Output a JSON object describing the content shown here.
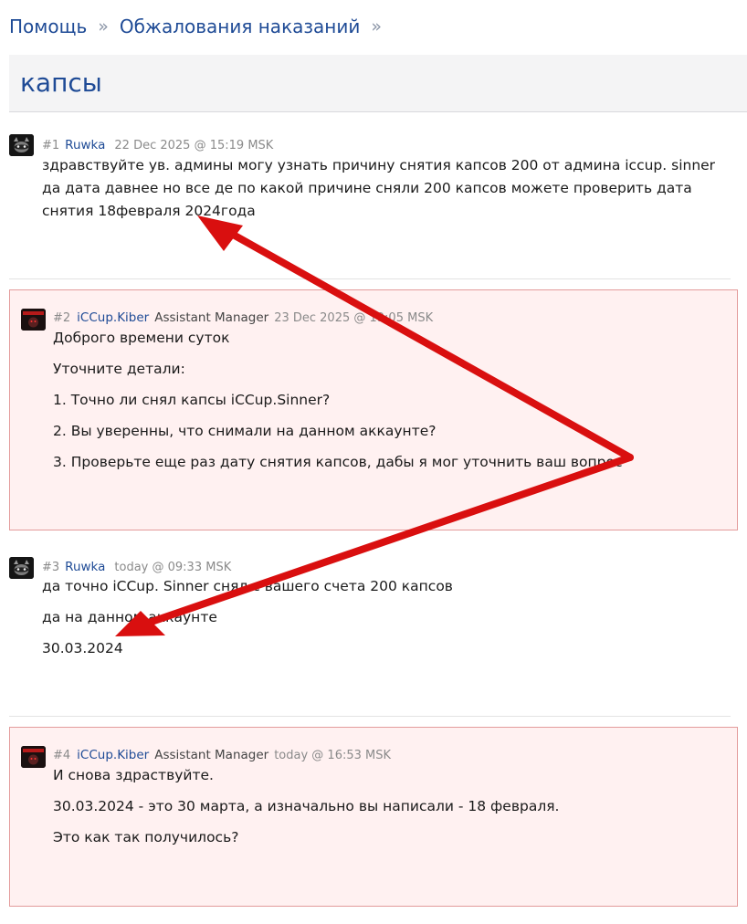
{
  "breadcrumb": {
    "items": [
      "Помощь",
      "Обжалования наказаний"
    ],
    "separator": "»"
  },
  "thread": {
    "title": "капсы"
  },
  "posts": [
    {
      "number": "#1",
      "author": "Ruwka",
      "role": "",
      "date": "22 Dec 2025 @ 15:19 MSK",
      "paragraphs": [
        "здравствуйте ув. админы могу узнать причину снятия капсов 200 от админа iccup. sinner да дата давнее но все де по какой причине сняли 200 капсов можете проверить дата снятия 18февраля 2024года"
      ]
    },
    {
      "number": "#2",
      "author": "iCCup.Kiber",
      "role": "Assistant Manager",
      "date": "23 Dec 2025 @ 19:05 MSK",
      "paragraphs": [
        "Доброго времени суток",
        "Уточните детали:",
        "1. Точно ли снял капсы iCCup.Sinner?",
        "2. Вы уверенны, что снимали на данном аккаунте?",
        "3. Проверьте еще раз дату снятия капсов, дабы я мог уточнить ваш вопрос"
      ]
    },
    {
      "number": "#3",
      "author": "Ruwka",
      "role": "",
      "date": "today @ 09:33 MSK",
      "paragraphs": [
        "да точно iCCup. Sinner снял с вашего счета 200 капсов",
        "да на данном аккаунте",
        "30.03.2024"
      ]
    },
    {
      "number": "#4",
      "author": "iCCup.Kiber",
      "role": "Assistant Manager",
      "date": "today @ 16:53 MSK",
      "paragraphs": [
        "И снова здраствуйте.",
        "30.03.2024 - это 30 марта, а изначально вы написали - 18 февраля.",
        "Это как так получилось?"
      ]
    }
  ],
  "colors": {
    "link": "#1f4b96",
    "staff_background": "#fff1f1",
    "staff_border": "#e39b9b",
    "arrow": "#d90f0f"
  },
  "icons": {
    "user_avatar": "raccoon-avatar-icon",
    "staff_avatar": "staff-avatar-icon"
  }
}
